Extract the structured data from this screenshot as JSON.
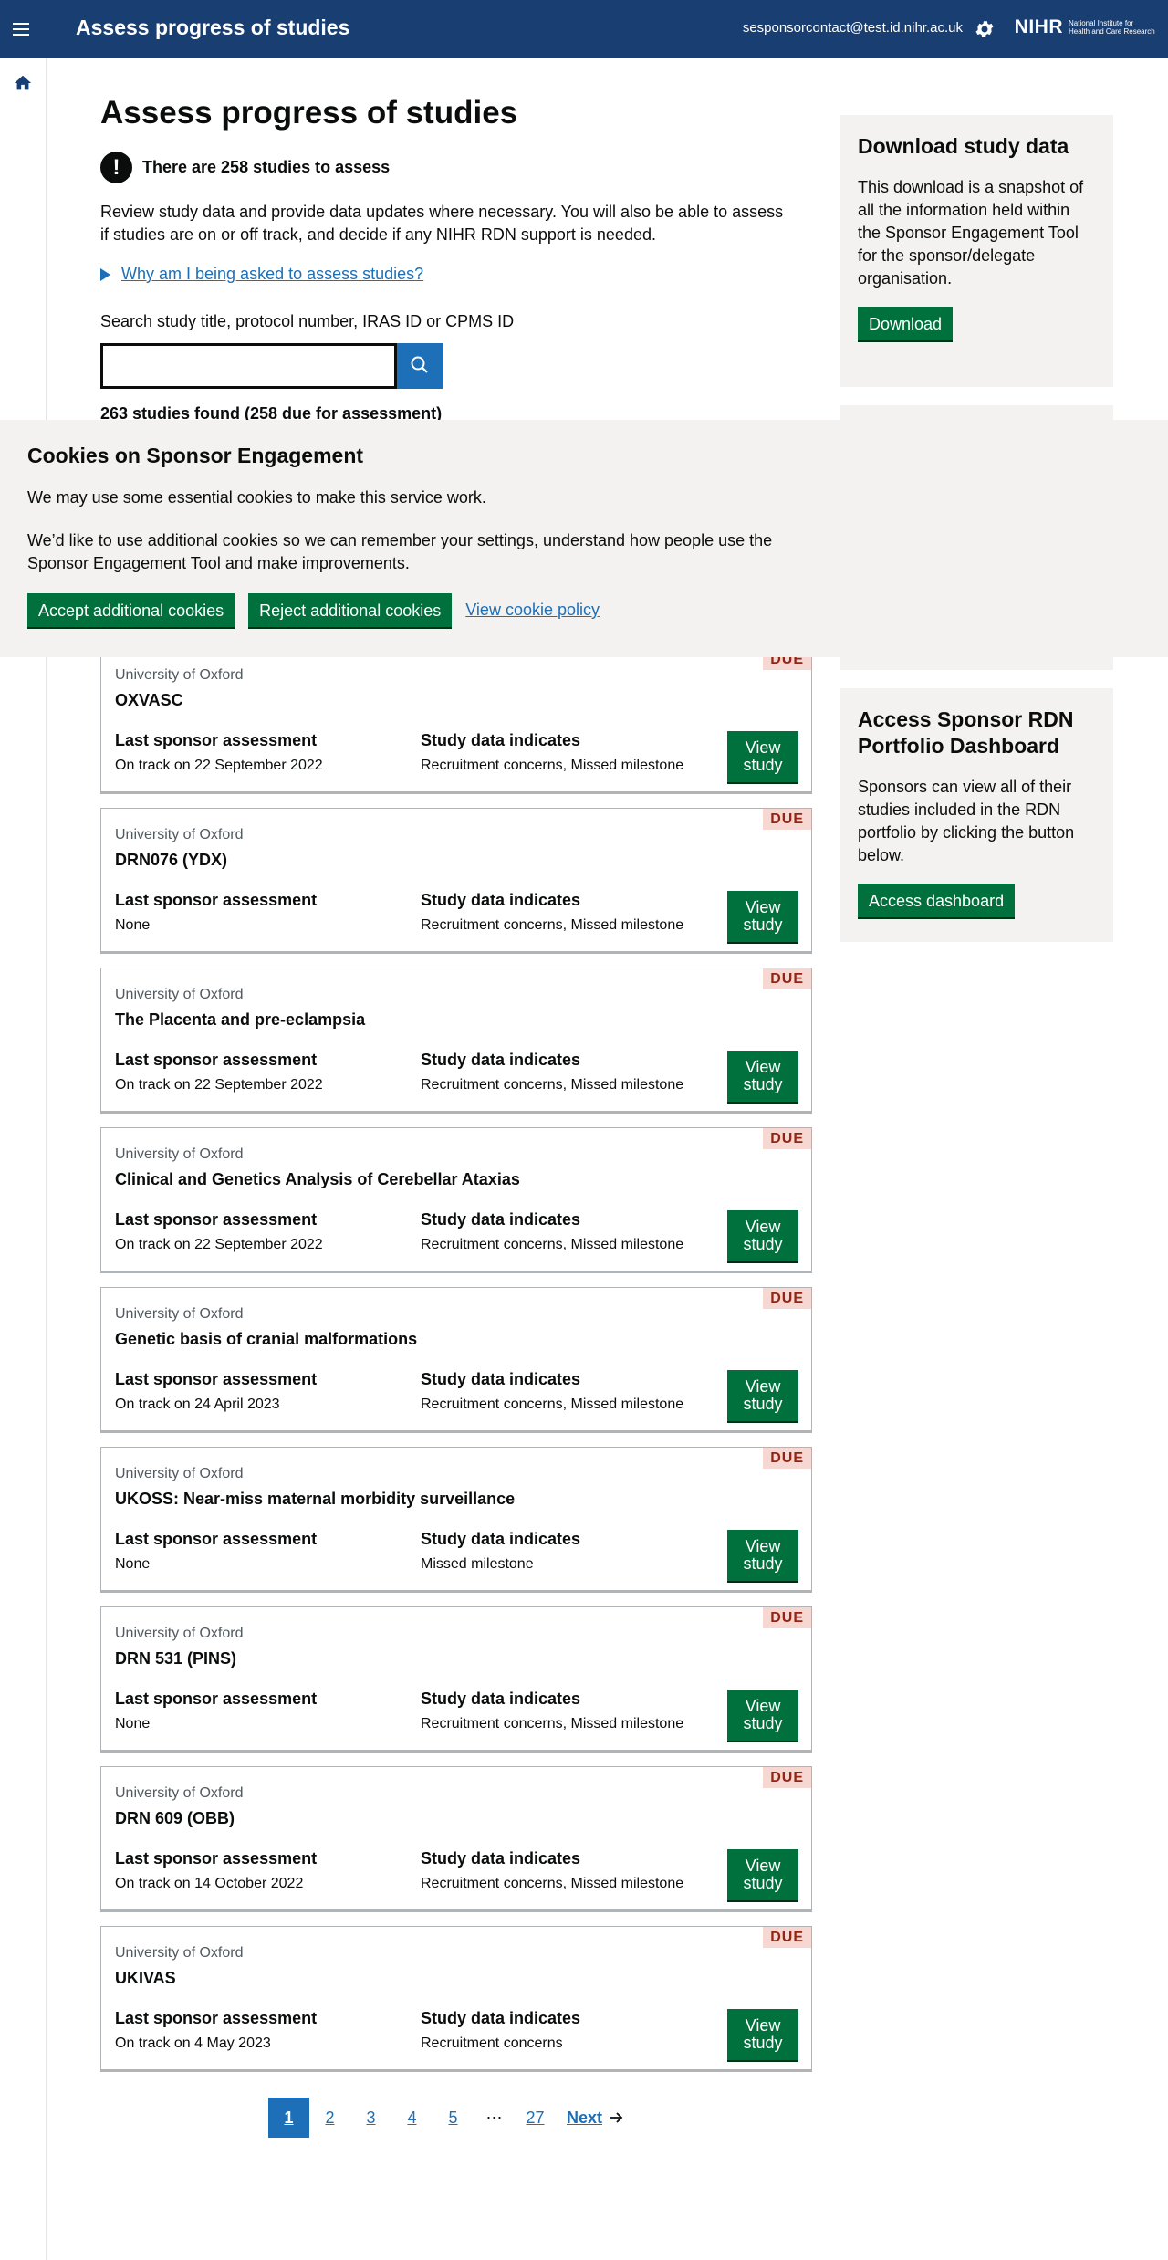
{
  "header": {
    "title": "Assess progress of studies",
    "user_email": "sesponsorcontact@test.id.nihr.ac.uk",
    "logo_text": "NIHR",
    "logo_subtext": "National Institute for Health and Care Research"
  },
  "main": {
    "title": "Assess progress of studies",
    "alert": "There are 258 studies to assess",
    "intro": "Review study data and provide data updates where necessary. You will also be able to assess if studies are on or off track, and decide if any NIHR RDN support is needed.",
    "details_link": "Why am I being asked to assess studies?",
    "search_label": "Search study title, protocol number, IRAS ID or CPMS ID",
    "search_value": "",
    "results_count": "263 studies found (258 due for assessment)"
  },
  "sidebar": {
    "download": {
      "heading": "Download study data",
      "text": "This download is a snapshot of all the information held within the Sponsor Engagement Tool for the sponsor/delegate organisation.",
      "button": "Download"
    },
    "dashboard": {
      "heading": "Access Sponsor RDN Portfolio Dashboard",
      "text": "Sponsors can view all of their studies included in the RDN portfolio by clicking the button below.",
      "button": "Access dashboard"
    }
  },
  "cookie_banner": {
    "heading": "Cookies on Sponsor Engagement",
    "text1": "We may use some essential cookies to make this service work.",
    "text2": "We’d like to use additional cookies so we can remember your settings, understand how people use the Sponsor Engagement Tool and make improvements.",
    "accept": "Accept additional cookies",
    "reject": "Reject additional cookies",
    "policy": "View cookie policy"
  },
  "card_labels": {
    "badge": "DUE",
    "last_assessment": "Last sponsor assessment",
    "data_indicates": "Study data indicates",
    "view_button": "View study"
  },
  "studies": [
    {
      "org": "University of Oxford",
      "title": "OXVASC",
      "last": "On track on 22 September 2022",
      "indicates": "Recruitment concerns, Missed milestone"
    },
    {
      "org": "University of Oxford",
      "title": "DRN076 (YDX)",
      "last": "None",
      "indicates": "Recruitment concerns, Missed milestone"
    },
    {
      "org": "University of Oxford",
      "title": "The Placenta and pre-eclampsia",
      "last": "On track on 22 September 2022",
      "indicates": "Recruitment concerns, Missed milestone"
    },
    {
      "org": "University of Oxford",
      "title": "Clinical and Genetics Analysis of Cerebellar Ataxias",
      "last": "On track on 22 September 2022",
      "indicates": "Recruitment concerns, Missed milestone"
    },
    {
      "org": "University of Oxford",
      "title": "Genetic basis of cranial malformations",
      "last": "On track on 24 April 2023",
      "indicates": "Recruitment concerns, Missed milestone"
    },
    {
      "org": "University of Oxford",
      "title": "UKOSS: Near-miss maternal morbidity surveillance",
      "last": "None",
      "indicates": "Missed milestone"
    },
    {
      "org": "University of Oxford",
      "title": "DRN 531 (PINS)",
      "last": "None",
      "indicates": "Recruitment concerns, Missed milestone"
    },
    {
      "org": "University of Oxford",
      "title": "DRN 609 (OBB)",
      "last": "On track on 14 October 2022",
      "indicates": "Recruitment concerns, Missed milestone"
    },
    {
      "org": "University of Oxford",
      "title": "UKIVAS",
      "last": "On track on 4 May 2023",
      "indicates": "Recruitment concerns"
    }
  ],
  "pagination": {
    "pages": [
      "1",
      "2",
      "3",
      "4",
      "5",
      "⋯",
      "27"
    ],
    "current": "1",
    "next": "Next"
  }
}
